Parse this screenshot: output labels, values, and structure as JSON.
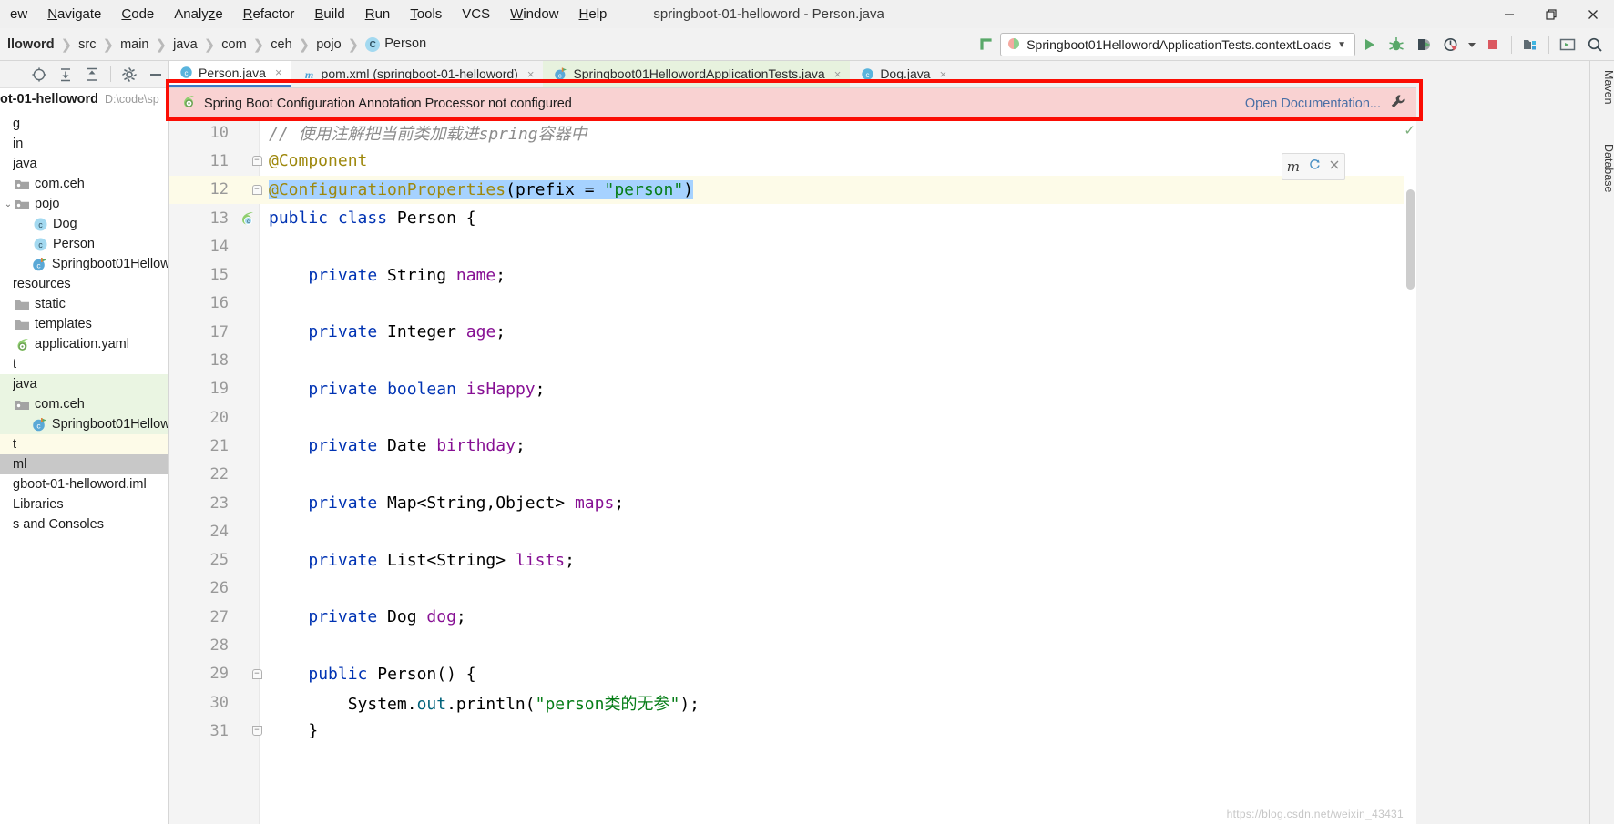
{
  "window": {
    "title": "springboot-01-helloword - Person.java",
    "controls": {
      "minimize": "minimize-icon",
      "maximize": "maximize-icon",
      "close": "close-icon"
    }
  },
  "menu": {
    "items": [
      {
        "label": "ew",
        "mnemonic": ""
      },
      {
        "label": "Navigate",
        "mnemonic": "N"
      },
      {
        "label": "Code",
        "mnemonic": "C"
      },
      {
        "label": "Analyze",
        "mnemonic": "z"
      },
      {
        "label": "Refactor",
        "mnemonic": "R"
      },
      {
        "label": "Build",
        "mnemonic": "B"
      },
      {
        "label": "Run",
        "mnemonic": "R"
      },
      {
        "label": "Tools",
        "mnemonic": "T"
      },
      {
        "label": "VCS",
        "mnemonic": ""
      },
      {
        "label": "Window",
        "mnemonic": "W"
      },
      {
        "label": "Help",
        "mnemonic": "H"
      }
    ]
  },
  "breadcrumb": {
    "items": [
      "lloword",
      "src",
      "main",
      "java",
      "com",
      "ceh",
      "pojo",
      "Person"
    ],
    "class_badge": "C"
  },
  "toolbar": {
    "run_config": "Springboot01HellowordApplicationTests.contextLoads",
    "dropdown_caret": "▼",
    "icons": [
      {
        "name": "run-icon",
        "tooltip": "Run"
      },
      {
        "name": "debug-icon",
        "tooltip": "Debug"
      },
      {
        "name": "run-coverage-icon",
        "tooltip": "Run with Coverage"
      },
      {
        "name": "profiler-icon",
        "tooltip": "Profile"
      },
      {
        "name": "stop-icon",
        "tooltip": "Stop"
      },
      {
        "name": "project-structure-icon",
        "tooltip": "Project Structure"
      },
      {
        "name": "terminal-icon",
        "tooltip": "Terminal"
      },
      {
        "name": "search-everywhere-icon",
        "tooltip": "Search Everywhere"
      }
    ]
  },
  "project_panel": {
    "header_name": "ot-01-helloword",
    "header_path": "D:\\code\\sp",
    "tree": [
      {
        "label": "g",
        "indent": 0,
        "icon": "none",
        "state": "none",
        "arrow": ""
      },
      {
        "label": "in",
        "indent": 0,
        "icon": "none",
        "state": "none",
        "arrow": ""
      },
      {
        "label": "java",
        "indent": 0,
        "icon": "none",
        "state": "none",
        "arrow": ""
      },
      {
        "label": "com.ceh",
        "indent": 1,
        "icon": "package",
        "state": "none",
        "arrow": ""
      },
      {
        "label": "pojo",
        "indent": 1,
        "icon": "package",
        "state": "none",
        "arrow": "v"
      },
      {
        "label": "Dog",
        "indent": 2,
        "icon": "class",
        "state": "none",
        "arrow": ""
      },
      {
        "label": "Person",
        "indent": 2,
        "icon": "class",
        "state": "none",
        "arrow": ""
      },
      {
        "label": "Springboot01Hellowo",
        "indent": 2,
        "icon": "springapp",
        "state": "none",
        "arrow": ""
      },
      {
        "label": "resources",
        "indent": 0,
        "icon": "none",
        "state": "none",
        "arrow": ""
      },
      {
        "label": "static",
        "indent": 1,
        "icon": "folder",
        "state": "none",
        "arrow": ""
      },
      {
        "label": "templates",
        "indent": 1,
        "icon": "folder",
        "state": "none",
        "arrow": ""
      },
      {
        "label": "application.yaml",
        "indent": 1,
        "icon": "spring",
        "state": "none",
        "arrow": ""
      },
      {
        "label": "t",
        "indent": 0,
        "icon": "none",
        "state": "none",
        "arrow": ""
      },
      {
        "label": "java",
        "indent": 0,
        "icon": "none",
        "state": "green",
        "arrow": ""
      },
      {
        "label": "com.ceh",
        "indent": 1,
        "icon": "package",
        "state": "green",
        "arrow": ""
      },
      {
        "label": "Springboot01Hellowo",
        "indent": 2,
        "icon": "springapp",
        "state": "green",
        "arrow": ""
      },
      {
        "label": "t",
        "indent": 0,
        "icon": "none",
        "state": "cream",
        "arrow": ""
      },
      {
        "label": "ml",
        "indent": 0,
        "icon": "none",
        "state": "gray",
        "arrow": ""
      },
      {
        "label": "gboot-01-helloword.iml",
        "indent": 0,
        "icon": "none",
        "state": "none",
        "arrow": ""
      },
      {
        "label": "Libraries",
        "indent": 0,
        "icon": "none",
        "state": "none",
        "arrow": ""
      },
      {
        "label": "s and Consoles",
        "indent": 0,
        "icon": "none",
        "state": "none",
        "arrow": ""
      }
    ]
  },
  "editor_tabs": [
    {
      "label": "Person.java",
      "icon": "java-class-icon",
      "state": "active",
      "close": "×"
    },
    {
      "label": "pom.xml (springboot-01-helloword)",
      "icon": "maven-icon",
      "state": "normal",
      "close": "×"
    },
    {
      "label": "Springboot01HellowordApplicationTests.java",
      "icon": "spring-test-icon",
      "state": "green",
      "close": "×"
    },
    {
      "label": "Dog.java",
      "icon": "java-class-icon",
      "state": "normal",
      "close": "×"
    }
  ],
  "banner": {
    "icon": "spring-leaf-icon",
    "message": "Spring Boot Configuration Annotation Processor not configured",
    "action_label": "Open Documentation...",
    "settings_icon": "wrench-icon"
  },
  "inspection_widget": {
    "label": "m",
    "refresh_icon": "refresh-icon",
    "close_icon": "close-icon",
    "status_check": "✓"
  },
  "right_tool_tabs": [
    {
      "label": "Maven"
    },
    {
      "label": "Database"
    }
  ],
  "editor": {
    "first_visible_line": 10,
    "caret_line": 12,
    "lines": [
      {
        "n": 10,
        "fold": "",
        "marker": "",
        "state": "normal",
        "tokens": [
          {
            "t": "// 使用注解把当前类加载进spring容器中",
            "c": "c"
          }
        ]
      },
      {
        "n": 11,
        "fold": "start",
        "marker": "",
        "state": "normal",
        "tokens": [
          {
            "t": "@Component",
            "c": "an"
          }
        ]
      },
      {
        "n": 12,
        "fold": "start",
        "marker": "",
        "state": "caret",
        "tokens": [
          {
            "t": "@ConfigurationProperties",
            "c": "an sel"
          },
          {
            "t": "(",
            "c": "p sel"
          },
          {
            "t": "prefix",
            "c": "p sel"
          },
          {
            "t": " = ",
            "c": "p sel"
          },
          {
            "t": "\"person\"",
            "c": "s sel"
          },
          {
            "t": ")",
            "c": "p sel"
          }
        ]
      },
      {
        "n": 13,
        "fold": "",
        "marker": "spring-bean-icon",
        "state": "normal",
        "tokens": [
          {
            "t": "public",
            "c": "k"
          },
          {
            "t": " ",
            "c": "p"
          },
          {
            "t": "class",
            "c": "k"
          },
          {
            "t": " Person {",
            "c": "p"
          }
        ]
      },
      {
        "n": 14,
        "fold": "",
        "marker": "",
        "state": "normal",
        "tokens": [
          {
            "t": "",
            "c": "p"
          }
        ]
      },
      {
        "n": 15,
        "fold": "",
        "marker": "",
        "state": "normal",
        "tokens": [
          {
            "t": "    ",
            "c": "p"
          },
          {
            "t": "private",
            "c": "k"
          },
          {
            "t": " String ",
            "c": "t"
          },
          {
            "t": "name",
            "c": "f"
          },
          {
            "t": ";",
            "c": "p"
          }
        ]
      },
      {
        "n": 16,
        "fold": "",
        "marker": "",
        "state": "normal",
        "tokens": [
          {
            "t": "",
            "c": "p"
          }
        ]
      },
      {
        "n": 17,
        "fold": "",
        "marker": "",
        "state": "normal",
        "tokens": [
          {
            "t": "    ",
            "c": "p"
          },
          {
            "t": "private",
            "c": "k"
          },
          {
            "t": " Integer ",
            "c": "t"
          },
          {
            "t": "age",
            "c": "f"
          },
          {
            "t": ";",
            "c": "p"
          }
        ]
      },
      {
        "n": 18,
        "fold": "",
        "marker": "",
        "state": "normal",
        "tokens": [
          {
            "t": "",
            "c": "p"
          }
        ]
      },
      {
        "n": 19,
        "fold": "",
        "marker": "",
        "state": "normal",
        "tokens": [
          {
            "t": "    ",
            "c": "p"
          },
          {
            "t": "private",
            "c": "k"
          },
          {
            "t": " ",
            "c": "p"
          },
          {
            "t": "boolean",
            "c": "k"
          },
          {
            "t": " ",
            "c": "p"
          },
          {
            "t": "isHappy",
            "c": "f"
          },
          {
            "t": ";",
            "c": "p"
          }
        ]
      },
      {
        "n": 20,
        "fold": "",
        "marker": "",
        "state": "normal",
        "tokens": [
          {
            "t": "",
            "c": "p"
          }
        ]
      },
      {
        "n": 21,
        "fold": "",
        "marker": "",
        "state": "normal",
        "tokens": [
          {
            "t": "    ",
            "c": "p"
          },
          {
            "t": "private",
            "c": "k"
          },
          {
            "t": " Date ",
            "c": "t"
          },
          {
            "t": "birthday",
            "c": "f"
          },
          {
            "t": ";",
            "c": "p"
          }
        ]
      },
      {
        "n": 22,
        "fold": "",
        "marker": "",
        "state": "normal",
        "tokens": [
          {
            "t": "",
            "c": "p"
          }
        ]
      },
      {
        "n": 23,
        "fold": "",
        "marker": "",
        "state": "normal",
        "tokens": [
          {
            "t": "    ",
            "c": "p"
          },
          {
            "t": "private",
            "c": "k"
          },
          {
            "t": " Map<String,Object> ",
            "c": "t"
          },
          {
            "t": "maps",
            "c": "f"
          },
          {
            "t": ";",
            "c": "p"
          }
        ]
      },
      {
        "n": 24,
        "fold": "",
        "marker": "",
        "state": "normal",
        "tokens": [
          {
            "t": "",
            "c": "p"
          }
        ]
      },
      {
        "n": 25,
        "fold": "",
        "marker": "",
        "state": "normal",
        "tokens": [
          {
            "t": "    ",
            "c": "p"
          },
          {
            "t": "private",
            "c": "k"
          },
          {
            "t": " List<String> ",
            "c": "t"
          },
          {
            "t": "lists",
            "c": "f"
          },
          {
            "t": ";",
            "c": "p"
          }
        ]
      },
      {
        "n": 26,
        "fold": "",
        "marker": "",
        "state": "normal",
        "tokens": [
          {
            "t": "",
            "c": "p"
          }
        ]
      },
      {
        "n": 27,
        "fold": "",
        "marker": "",
        "state": "normal",
        "tokens": [
          {
            "t": "    ",
            "c": "p"
          },
          {
            "t": "private",
            "c": "k"
          },
          {
            "t": " Dog ",
            "c": "t"
          },
          {
            "t": "dog",
            "c": "f"
          },
          {
            "t": ";",
            "c": "p"
          }
        ]
      },
      {
        "n": 28,
        "fold": "",
        "marker": "",
        "state": "normal",
        "tokens": [
          {
            "t": "",
            "c": "p"
          }
        ]
      },
      {
        "n": 29,
        "fold": "start",
        "marker": "",
        "state": "normal",
        "tokens": [
          {
            "t": "    ",
            "c": "p"
          },
          {
            "t": "public",
            "c": "k"
          },
          {
            "t": " ",
            "c": "p"
          },
          {
            "t": "Person",
            "c": "t"
          },
          {
            "t": "() {",
            "c": "p"
          }
        ]
      },
      {
        "n": 30,
        "fold": "",
        "marker": "",
        "state": "normal",
        "tokens": [
          {
            "t": "        System.",
            "c": "p"
          },
          {
            "t": "out",
            "c": "st"
          },
          {
            "t": ".println(",
            "c": "p"
          },
          {
            "t": "\"person类的无参\"",
            "c": "s"
          },
          {
            "t": ");",
            "c": "p"
          }
        ]
      },
      {
        "n": 31,
        "fold": "end",
        "marker": "",
        "state": "normal",
        "tokens": [
          {
            "t": "    }",
            "c": "p"
          }
        ]
      }
    ]
  },
  "watermark": "https://blog.csdn.net/weixin_43431"
}
